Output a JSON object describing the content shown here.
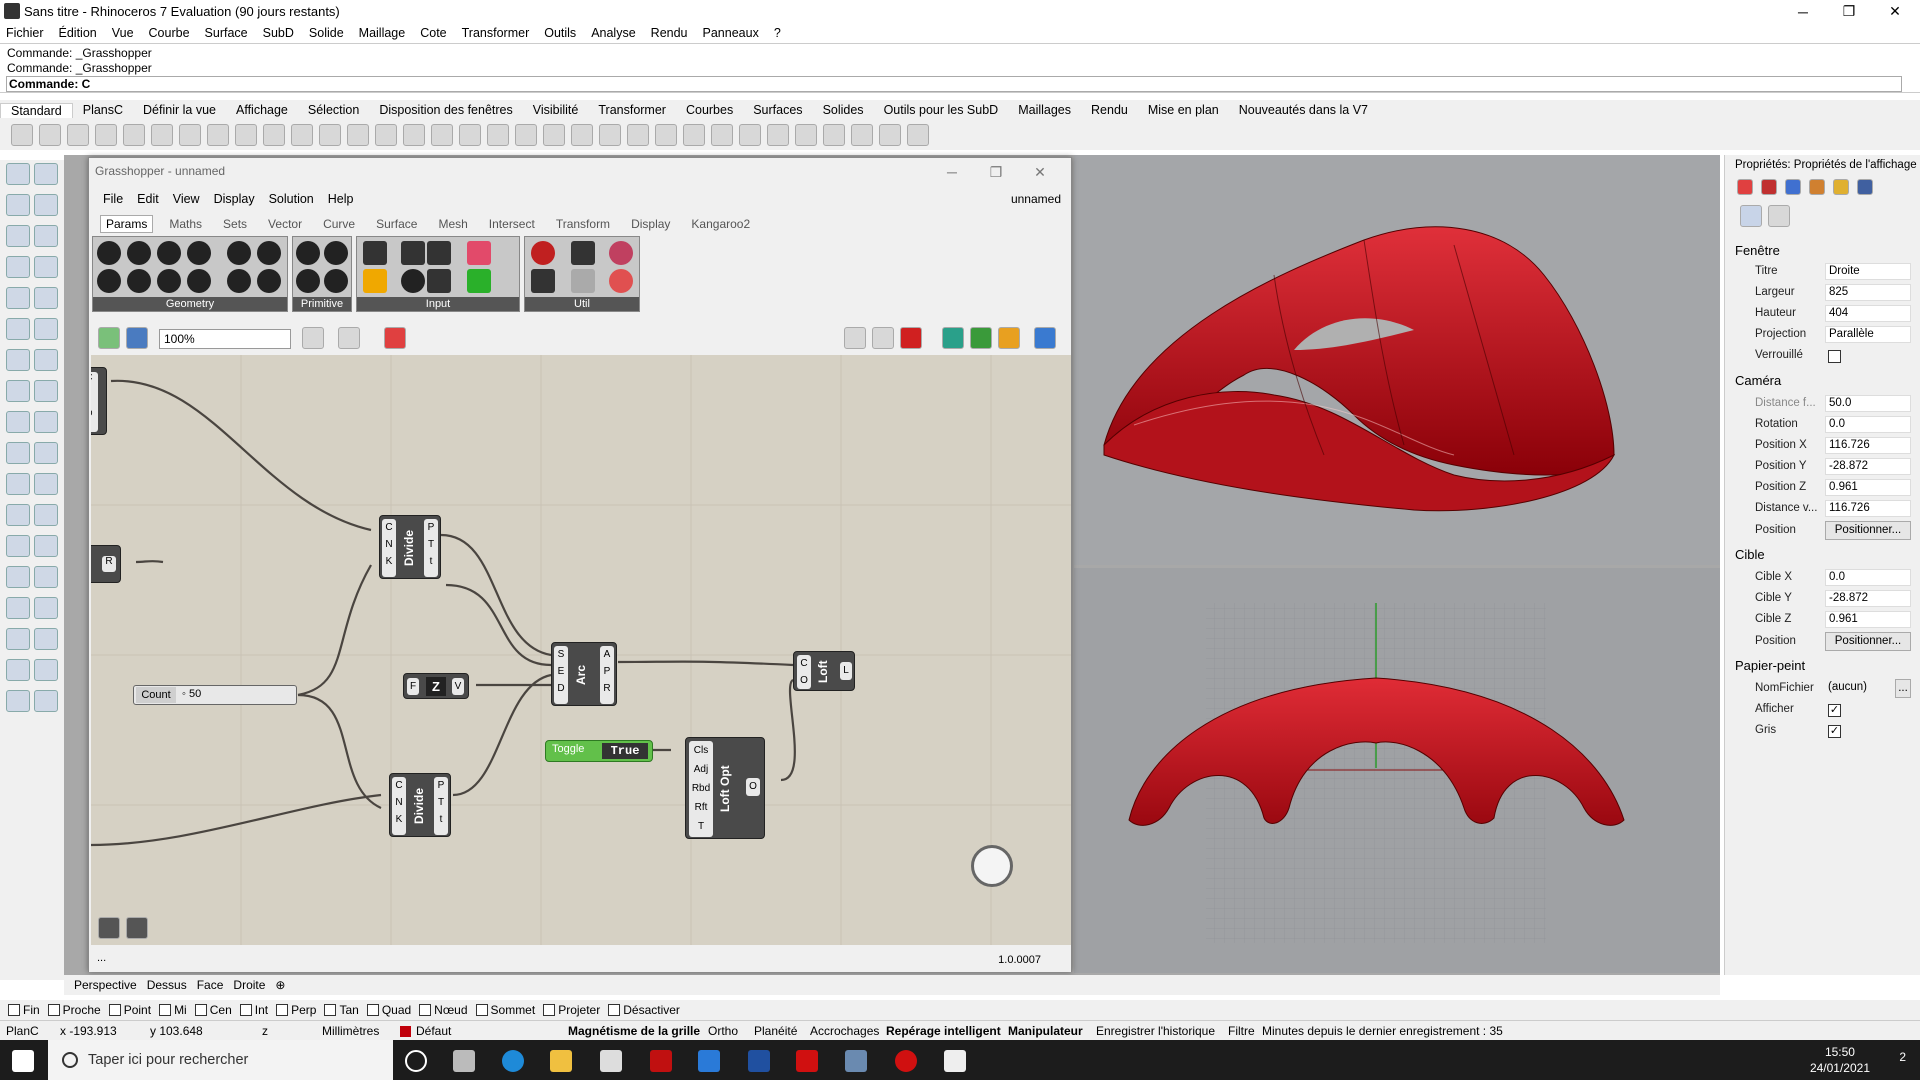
{
  "window": {
    "title": "Sans titre - Rhinoceros 7 Evaluation (90 jours restants)",
    "min": "─",
    "max": "❐",
    "close": "✕"
  },
  "menu": [
    "Fichier",
    "Édition",
    "Vue",
    "Courbe",
    "Surface",
    "SubD",
    "Solide",
    "Maillage",
    "Cote",
    "Transformer",
    "Outils",
    "Analyse",
    "Rendu",
    "Panneaux",
    "?"
  ],
  "command": {
    "history": [
      "Commande: _Grasshopper",
      "Commande: _Grasshopper"
    ],
    "prompt": "Commande: C"
  },
  "toolbar_tabs": [
    "Standard",
    "PlansC",
    "Définir la vue",
    "Affichage",
    "Sélection",
    "Disposition des fenêtres",
    "Visibilité",
    "Transformer",
    "Courbes",
    "Surfaces",
    "Solides",
    "Outils pour les SubD",
    "Maillages",
    "Rendu",
    "Mise en plan",
    "Nouveautés dans la V7"
  ],
  "grasshopper": {
    "title": "Grasshopper - unnamed",
    "file": "unnamed",
    "menu": [
      "File",
      "Edit",
      "View",
      "Display",
      "Solution",
      "Help"
    ],
    "tabs": [
      "Params",
      "Maths",
      "Sets",
      "Vector",
      "Curve",
      "Surface",
      "Mesh",
      "Intersect",
      "Transform",
      "Display",
      "Kangaroo2"
    ],
    "groups": [
      "Geometry",
      "Primitive",
      "Input",
      "Util"
    ],
    "zoom": "100%",
    "version": "1.0.0007",
    "status_dots": "...",
    "nodes": {
      "divide1": {
        "name": "Divide",
        "in": [
          "C",
          "N",
          "K"
        ],
        "out": [
          "P",
          "T",
          "t"
        ]
      },
      "divide2": {
        "name": "Divide",
        "in": [
          "C",
          "N",
          "K"
        ],
        "out": [
          "P",
          "T",
          "t"
        ]
      },
      "arc": {
        "name": "Arc",
        "in": [
          "S",
          "E",
          "D"
        ],
        "out": [
          "A",
          "P",
          "R"
        ]
      },
      "loft": {
        "name": "Loft",
        "in": [
          "C",
          "O"
        ],
        "out": [
          "L"
        ]
      },
      "loftopt": {
        "name": "Loft Opt",
        "in": [
          "Cls",
          "Adj",
          "Rbd",
          "Rft",
          "T"
        ],
        "out": [
          "O"
        ]
      },
      "unitz": {
        "name": "Z",
        "in": [
          "F"
        ],
        "out": [
          "V"
        ]
      },
      "left_in": [
        "C",
        "L",
        "D"
      ],
      "left_r": "R"
    },
    "slider": {
      "label": "Count",
      "value": "◦ 50"
    },
    "toggle": {
      "label": "Toggle",
      "value": "True"
    }
  },
  "props": {
    "title": "Propriétés: Propriétés de l'affichage",
    "fenetre": "Fenêtre",
    "fields1": [
      {
        "l": "Titre",
        "v": "Droite"
      },
      {
        "l": "Largeur",
        "v": "825"
      },
      {
        "l": "Hauteur",
        "v": "404"
      },
      {
        "l": "Projection",
        "v": "Parallèle"
      }
    ],
    "verrouille": "Verrouillé",
    "camera": "Caméra",
    "fields2": [
      {
        "l": "Distance f...",
        "v": "50.0"
      },
      {
        "l": "Rotation",
        "v": "0.0"
      },
      {
        "l": "Position X",
        "v": "116.726"
      },
      {
        "l": "Position Y",
        "v": "-28.872"
      },
      {
        "l": "Position Z",
        "v": "0.961"
      },
      {
        "l": "Distance v...",
        "v": "116.726"
      }
    ],
    "position": "Position",
    "positionner": "Positionner...",
    "cible": "Cible",
    "fields3": [
      {
        "l": "Cible X",
        "v": "0.0"
      },
      {
        "l": "Cible Y",
        "v": "-28.872"
      },
      {
        "l": "Cible Z",
        "v": "0.961"
      }
    ],
    "papier": "Papier-peint",
    "nomfichier": "NomFichier",
    "nomval": "(aucun)",
    "afficher": "Afficher",
    "gris": "Gris",
    "dots": "..."
  },
  "viewport_tabs": [
    "Perspective",
    "Dessus",
    "Face",
    "Droite"
  ],
  "osnaps": [
    "Fin",
    "Proche",
    "Point",
    "Mi",
    "Cen",
    "Int",
    "Perp",
    "Tan",
    "Quad",
    "Nœud",
    "Sommet",
    "Projeter",
    "Désactiver"
  ],
  "status": {
    "plan": "PlanC",
    "x": "x -193.913",
    "y": "y 103.648",
    "z": "z",
    "units": "Millimètres",
    "layer": "Défaut",
    "grid": "Magnétisme de la grille",
    "ortho": "Ortho",
    "planeite": "Planéité",
    "accroch": "Accrochages",
    "reperage": "Repérage intelligent",
    "manip": "Manipulateur",
    "hist": "Enregistrer l'historique",
    "filtre": "Filtre",
    "minutes": "Minutes depuis le dernier enregistrement : 35"
  },
  "taskbar": {
    "search": "Taper ici pour rechercher",
    "time": "15:50",
    "date": "24/01/2021",
    "notif": "2"
  },
  "colors": {
    "accent_red": "#c0000a",
    "gh_canvas": "#d6d1c4",
    "toggle_green": "#5fb848"
  }
}
